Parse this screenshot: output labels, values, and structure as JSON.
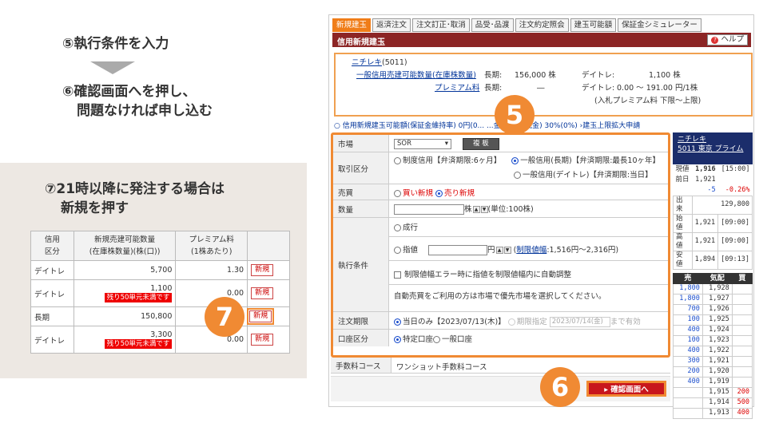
{
  "left": {
    "step5": "⑤執行条件を入力",
    "step6_line1": "⑥確認画面へを押し、",
    "step6_line2": "問題なければ申し込む",
    "step7_line1": "⑦21時以降に発注する場合は",
    "step7_line2": "新規を押す",
    "table": {
      "headers": [
        "信用\n区分",
        "新規売建可能数量\n(在庫株数量)(株(口))",
        "プレミアム料\n(1株あたり)",
        ""
      ],
      "rows": [
        {
          "type": "デイトレ",
          "qty": "5,700",
          "warn": "",
          "premium": "1.30",
          "btn": "新規"
        },
        {
          "type": "デイトレ",
          "qty": "1,100",
          "warn": "残り50単元未満です",
          "premium": "0.00",
          "btn": "新規"
        },
        {
          "type": "長期",
          "qty": "150,800",
          "warn": "",
          "premium": "",
          "btn": "新規"
        },
        {
          "type": "デイトレ",
          "qty": "3,300",
          "warn": "残り50単元未満です",
          "premium": "0.00",
          "btn": "新規"
        }
      ]
    },
    "badge7": "7"
  },
  "panel": {
    "tabs": [
      "新規建玉",
      "返済注文",
      "注文訂正･取消",
      "品受･品渡",
      "注文約定照会",
      "建玉可能額",
      "保証金シミュレーター"
    ],
    "title": "信用新規建玉",
    "help": "ヘルプ",
    "info": {
      "stock_name": "ニチレキ",
      "stock_code": "(5011)",
      "qty_link": "一般信用売建可能数量(在庫株数量)",
      "premium_link": "プレミアム料",
      "long_label": "長期:",
      "long_qty": "156,000 株",
      "long_premium": "―",
      "day_label": "デイトレ:",
      "day_qty": "1,100 株",
      "day_premium": "0.00 ～ 191.00 円/1株",
      "note": "(入札プレミアム料 下限～上限)"
    },
    "margin_line": "○ 信用新規建玉可能額(保証金維持率)  0円(0...     ...金率(うち現金) 30%(0%)  ›建玉上限拡大申請",
    "badge5": "5",
    "form": {
      "market_label": "市場",
      "market_value": "SOR",
      "market_btn": "複 板",
      "trade_label": "取引区分",
      "trade_opt1": "制度信用【弁済期限:6ヶ月】",
      "trade_opt2": "一般信用(長期)【弁済期限:最長10ヶ年】",
      "trade_opt3": "一般信用(デイトレ)【弁済期限:当日】",
      "side_label": "売買",
      "side_buy": "買い新規",
      "side_sell": "売り新規",
      "qty_label": "数量",
      "qty_unit": "株",
      "qty_note": "(単位:100株)",
      "exec_label": "執行条件",
      "exec_market": "成行",
      "exec_limit": "指値",
      "yen": "円",
      "limit_link": "制限値幅",
      "limit_range": ":1,516円～2,316円)",
      "adjust": "制限値幅エラー時に指値を制限値幅内に自動調整",
      "auto_note": "自動売買をご利用の方は市場で優先市場を選択してください。",
      "period_label": "注文期限",
      "period_today": "当日のみ【2023/07/13(木)】",
      "period_specify": "期限指定",
      "period_date": "2023/07/14(金)",
      "period_until": "まで有効",
      "account_label": "口座区分",
      "account_specific": "特定口座",
      "account_general": "一般口座"
    },
    "fee_label": "手数料コース",
    "fee_value": "ワンショット手数料コース",
    "badge6": "6",
    "confirm": "▸ 確認画面へ"
  },
  "quote": {
    "name": "ニチレキ",
    "code_market": "5011 東京 プライム",
    "rows": [
      {
        "label": "現値",
        "price": "1,916",
        "time": "[15:00]"
      },
      {
        "label": "前日",
        "price": "1,921",
        "time": ""
      },
      {
        "label": "",
        "price": "-5",
        "time": "-0.26%"
      },
      {
        "label": "出来",
        "price": "",
        "time": "129,800"
      },
      {
        "label": "始値",
        "price": "1,921",
        "time": "[09:00]"
      },
      {
        "label": "高値",
        "price": "1,921",
        "time": "[09:00]"
      },
      {
        "label": "安値",
        "price": "1,894",
        "time": "[09:13]"
      }
    ],
    "book_headers": [
      "売",
      "気配",
      "買"
    ],
    "book": [
      {
        "sell": "1,800",
        "price": "1,928",
        "buy": ""
      },
      {
        "sell": "1,800",
        "price": "1,927",
        "buy": ""
      },
      {
        "sell": "700",
        "price": "1,926",
        "buy": ""
      },
      {
        "sell": "100",
        "price": "1,925",
        "buy": ""
      },
      {
        "sell": "400",
        "price": "1,924",
        "buy": ""
      },
      {
        "sell": "100",
        "price": "1,923",
        "buy": ""
      },
      {
        "sell": "400",
        "price": "1,922",
        "buy": ""
      },
      {
        "sell": "300",
        "price": "1,921",
        "buy": ""
      },
      {
        "sell": "200",
        "price": "1,920",
        "buy": ""
      },
      {
        "sell": "400",
        "price": "1,919",
        "buy": ""
      },
      {
        "sell": "",
        "price": "1,915",
        "buy": "200"
      },
      {
        "sell": "",
        "price": "1,914",
        "buy": "500"
      },
      {
        "sell": "",
        "price": "1,913",
        "buy": "400"
      }
    ]
  },
  "colors": {
    "accent": "#f08a33",
    "title_bar": "#8c2525",
    "confirm": "#c8161d",
    "quote_head": "#1b2d6b"
  }
}
